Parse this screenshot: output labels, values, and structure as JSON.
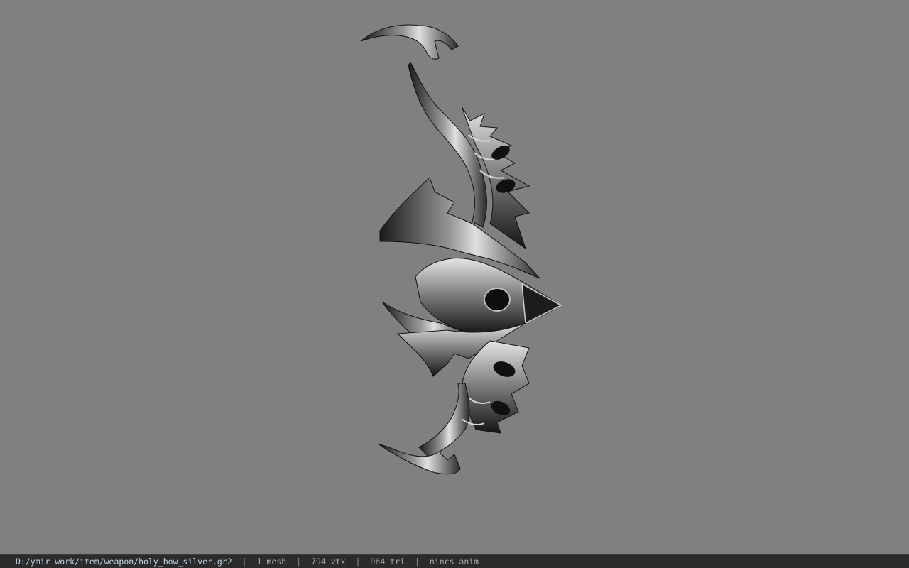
{
  "viewer": {
    "background_color": "#808080",
    "model_icon": "holy-bow-model"
  },
  "status": {
    "file_path": "D:/ymir work/item/weapon/holy_bow_silver.gr2",
    "separator": "|",
    "mesh_count": "1 mesh",
    "vertex_count": "794 vtx",
    "triangle_count": "964 tri",
    "animation_info": "nincs anim"
  }
}
